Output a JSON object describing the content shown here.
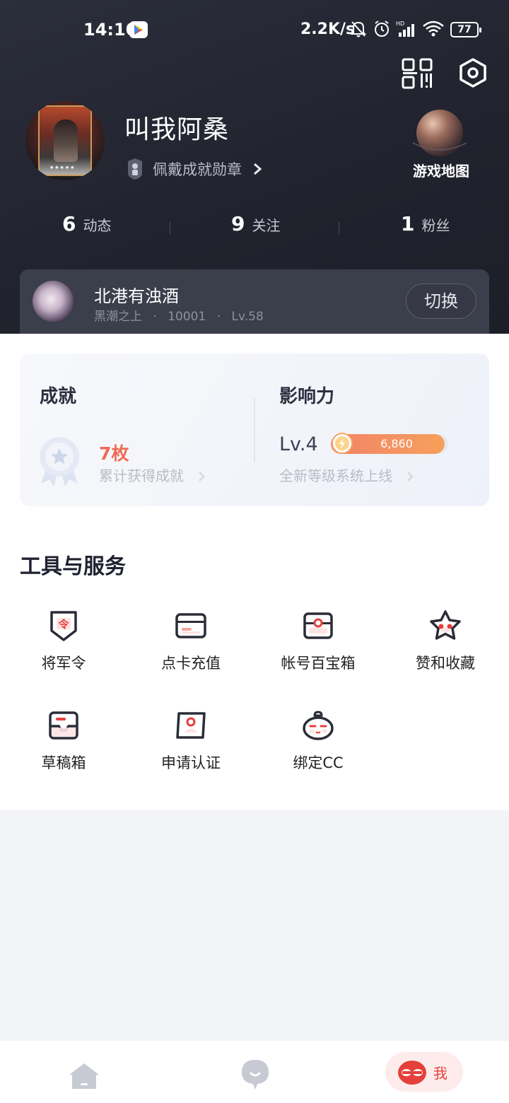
{
  "status_bar": {
    "time": "14:10",
    "network_speed": "2.2K/s",
    "battery": "77"
  },
  "profile": {
    "username": "叫我阿桑",
    "badge_text": "佩戴成就勋章",
    "game_map_label": "游戏地图"
  },
  "stats": [
    {
      "count": "6",
      "label": "动态"
    },
    {
      "count": "9",
      "label": "关注"
    },
    {
      "count": "1",
      "label": "粉丝"
    }
  ],
  "role": {
    "name": "北港有浊酒",
    "server": "黑潮之上",
    "id": "10001",
    "level": "Lv.58",
    "dot": "·",
    "switch_label": "切换"
  },
  "achievement": {
    "title": "成就",
    "count": "7枚",
    "desc": "累计获得成就"
  },
  "influence": {
    "title": "影响力",
    "level": "Lv.4",
    "points": "6,860",
    "progress_fraction": 0.97,
    "desc": "全新等级系统上线"
  },
  "tools": {
    "title": "工具与服务",
    "items": [
      {
        "label": "将军令",
        "icon": "token-icon"
      },
      {
        "label": "点卡充值",
        "icon": "card-icon"
      },
      {
        "label": "帐号百宝箱",
        "icon": "treasure-box-icon"
      },
      {
        "label": "赞和收藏",
        "icon": "star-icon"
      },
      {
        "label": "草稿箱",
        "icon": "drafts-icon"
      },
      {
        "label": "申请认证",
        "icon": "verify-icon"
      },
      {
        "label": "绑定CC",
        "icon": "cc-icon"
      }
    ]
  },
  "tabbar": {
    "me_label": "我"
  },
  "colors": {
    "accent": "#e5403b",
    "header_bg": "#23252f",
    "orange": "#f06a55"
  }
}
